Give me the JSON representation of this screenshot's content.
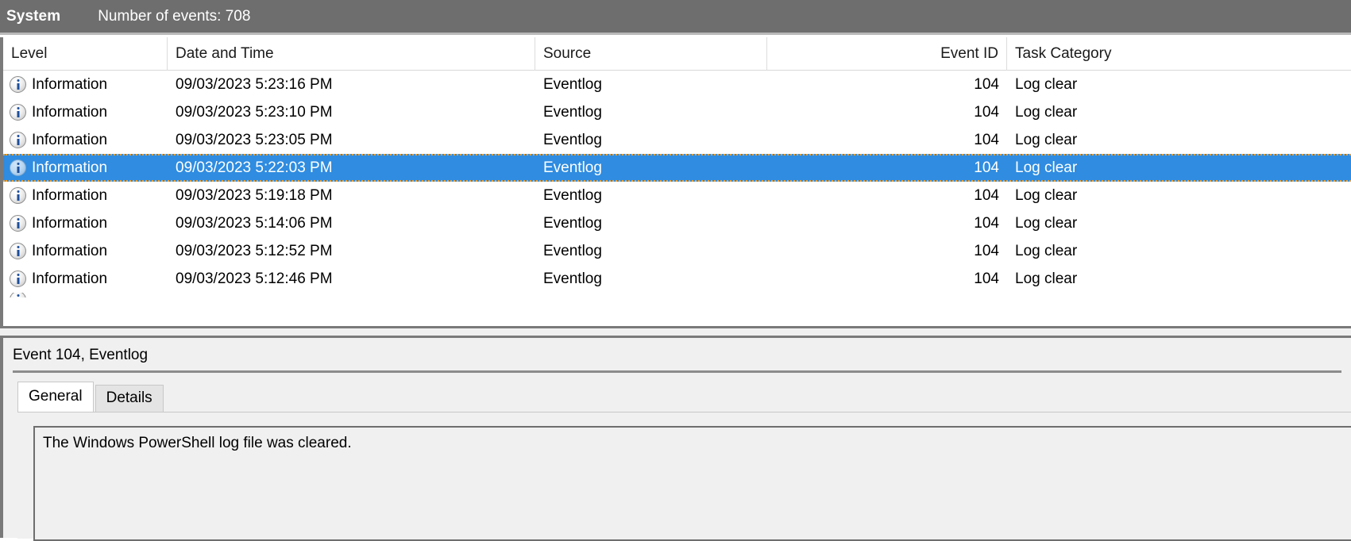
{
  "header": {
    "log_name": "System",
    "event_count_label": "Number of events: 708",
    "background_color": "#6e6e6e",
    "text_color": "#ffffff"
  },
  "list": {
    "columns": [
      {
        "key": "level",
        "label": "Level",
        "align": "left"
      },
      {
        "key": "datetime",
        "label": "Date and Time",
        "align": "left"
      },
      {
        "key": "source",
        "label": "Source",
        "align": "left"
      },
      {
        "key": "event_id",
        "label": "Event ID",
        "align": "right"
      },
      {
        "key": "task_category",
        "label": "Task Category",
        "align": "left"
      }
    ],
    "selection_color": "#2f8ce0",
    "focus_border_color": "#f0a030",
    "rows": [
      {
        "icon": "information-icon",
        "level": "Information",
        "datetime": "09/03/2023 5:23:16 PM",
        "source": "Eventlog",
        "event_id": "104",
        "task_category": "Log clear",
        "selected": false
      },
      {
        "icon": "information-icon",
        "level": "Information",
        "datetime": "09/03/2023 5:23:10 PM",
        "source": "Eventlog",
        "event_id": "104",
        "task_category": "Log clear",
        "selected": false
      },
      {
        "icon": "information-icon",
        "level": "Information",
        "datetime": "09/03/2023 5:23:05 PM",
        "source": "Eventlog",
        "event_id": "104",
        "task_category": "Log clear",
        "selected": false
      },
      {
        "icon": "information-icon",
        "level": "Information",
        "datetime": "09/03/2023 5:22:03 PM",
        "source": "Eventlog",
        "event_id": "104",
        "task_category": "Log clear",
        "selected": true
      },
      {
        "icon": "information-icon",
        "level": "Information",
        "datetime": "09/03/2023 5:19:18 PM",
        "source": "Eventlog",
        "event_id": "104",
        "task_category": "Log clear",
        "selected": false
      },
      {
        "icon": "information-icon",
        "level": "Information",
        "datetime": "09/03/2023 5:14:06 PM",
        "source": "Eventlog",
        "event_id": "104",
        "task_category": "Log clear",
        "selected": false
      },
      {
        "icon": "information-icon",
        "level": "Information",
        "datetime": "09/03/2023 5:12:52 PM",
        "source": "Eventlog",
        "event_id": "104",
        "task_category": "Log clear",
        "selected": false
      },
      {
        "icon": "information-icon",
        "level": "Information",
        "datetime": "09/03/2023 5:12:46 PM",
        "source": "Eventlog",
        "event_id": "104",
        "task_category": "Log clear",
        "selected": false
      }
    ]
  },
  "details": {
    "title": "Event 104, Eventlog",
    "tabs": [
      {
        "label": "General",
        "active": true
      },
      {
        "label": "Details",
        "active": false
      }
    ],
    "message": "The Windows PowerShell log file was cleared."
  }
}
